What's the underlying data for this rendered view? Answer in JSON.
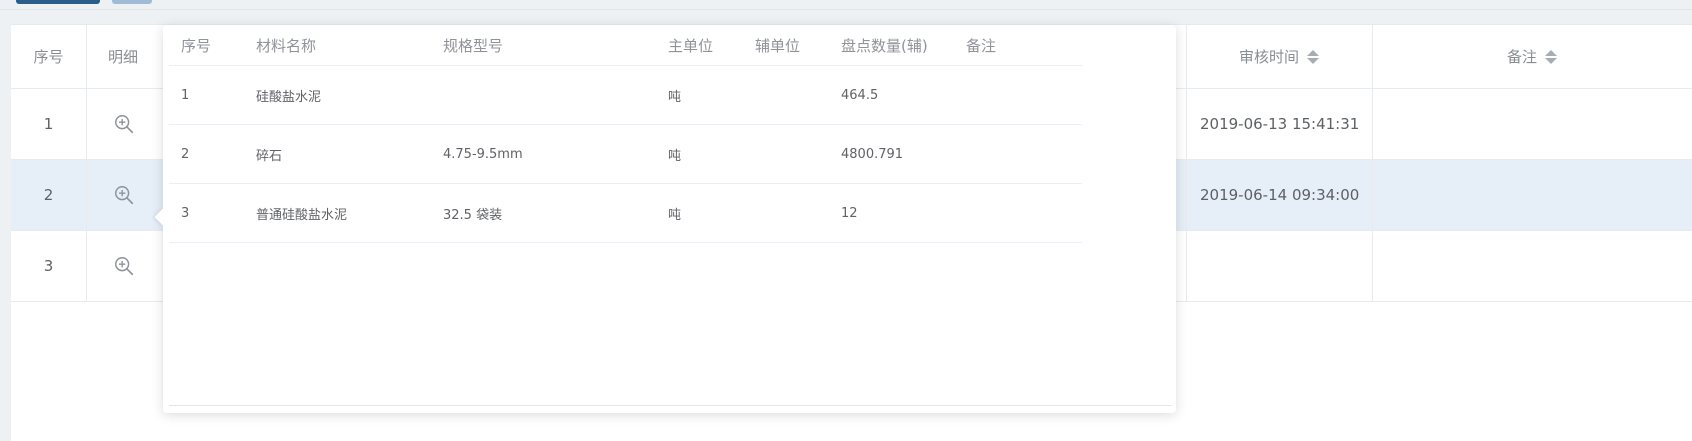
{
  "toolbar": {
    "buttons": [
      "",
      ""
    ]
  },
  "main_table": {
    "headers": {
      "index": "序号",
      "detail": "明细",
      "audit_time": "审核时间",
      "remark": "备注"
    },
    "rows": [
      {
        "index": "1",
        "audit_time": "2019-06-13 15:41:31",
        "remark": ""
      },
      {
        "index": "2",
        "audit_time": "2019-06-14 09:34:00",
        "remark": ""
      },
      {
        "index": "3",
        "audit_time": "",
        "remark": ""
      }
    ],
    "detail_icon": "zoom-in-icon",
    "sort_icon": "sort-caret-icon"
  },
  "detail_popover": {
    "headers": {
      "index": "序号",
      "material_name": "材料名称",
      "spec": "规格型号",
      "main_unit": "主单位",
      "aux_unit": "辅单位",
      "count_qty": "盘点数量(辅)",
      "remark": "备注"
    },
    "rows": [
      {
        "index": "1",
        "material_name": "硅酸盐水泥",
        "spec": "",
        "main_unit": "吨",
        "aux_unit": "",
        "count_qty": "464.5",
        "remark": ""
      },
      {
        "index": "2",
        "material_name": "碎石",
        "spec": "4.75-9.5mm",
        "main_unit": "吨",
        "aux_unit": "",
        "count_qty": "4800.791",
        "remark": ""
      },
      {
        "index": "3",
        "material_name": "普通硅酸盐水泥",
        "spec": "32.5 袋装",
        "main_unit": "吨",
        "aux_unit": "",
        "count_qty": "12",
        "remark": ""
      }
    ]
  },
  "colors": {
    "primary_button": "#2a5d89",
    "secondary_button": "#9fbcd6",
    "row_highlight": "#e6eef7",
    "page_background": "#eef1f4"
  }
}
